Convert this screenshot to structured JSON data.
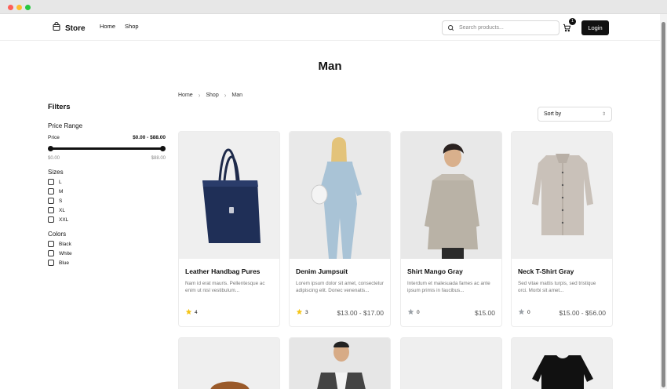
{
  "header": {
    "brand": "Store",
    "nav": [
      "Home",
      "Shop"
    ],
    "search_placeholder": "Search products...",
    "cart_count": "1",
    "login": "Login"
  },
  "page": {
    "title": "Man",
    "breadcrumb": [
      "Home",
      "Shop",
      "Man"
    ],
    "sort_label": "Sort by"
  },
  "filters": {
    "title": "Filters",
    "price_range_title": "Price Range",
    "price_label": "Price",
    "price_value": "$0.00 - $88.00",
    "min_label": "$0.00",
    "max_label": "$88.00",
    "sizes_title": "Sizes",
    "sizes": [
      "L",
      "M",
      "S",
      "XL",
      "XXL"
    ],
    "colors_title": "Colors",
    "colors": [
      "Black",
      "White",
      "Blue"
    ]
  },
  "products": [
    {
      "name": "Leather Handbag Pures",
      "desc": "Nam id erat mauris. Pellentesque ac enim ut nisl vestibulum...",
      "rating": "4",
      "price": ""
    },
    {
      "name": "Denim Jumpsuit",
      "desc": "Lorem ipsum dolor sit amet, consectetur adipiscing elit. Donec venenatis...",
      "rating": "3",
      "price": "$13.00 - $17.00"
    },
    {
      "name": "Shirt Mango Gray",
      "desc": "Interdum et malesuada fames ac ante ipsum primis in faucibus...",
      "rating": "0",
      "price": "$15.00"
    },
    {
      "name": "Neck T-Shirt Gray",
      "desc": "Sed vitae mattis turpis, sed tristique orci. Morbi sit amet...",
      "rating": "0",
      "price": "$15.00 - $56.00"
    }
  ],
  "colors": {
    "accent": "#111111",
    "star_filled": "#f5c518",
    "star_empty": "#9aa0a6"
  }
}
